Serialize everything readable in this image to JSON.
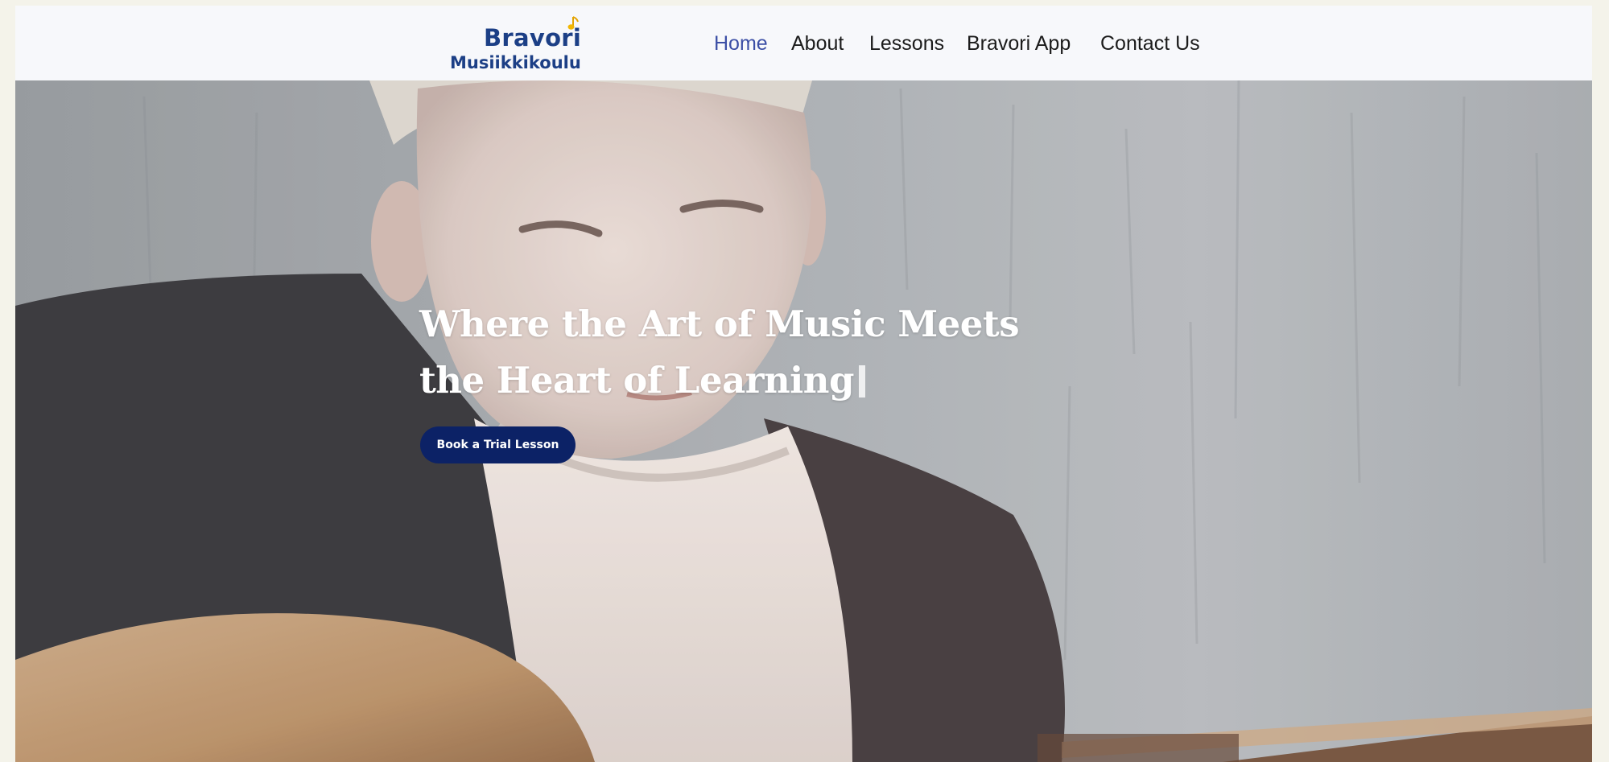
{
  "brand": {
    "name_line1": "Bravori",
    "name_line2": "Musiikkikoulu",
    "accent_color": "#1c3f86",
    "note_icon": "music-note-icon",
    "note_color": "#f2b705"
  },
  "nav": {
    "items": [
      {
        "label": "Home",
        "active": true
      },
      {
        "label": "About",
        "active": false
      },
      {
        "label": "Lessons",
        "active": false
      },
      {
        "label": "Bravori App",
        "active": false
      },
      {
        "label": "Contact Us",
        "active": false
      }
    ],
    "active_color": "#3c4fa6"
  },
  "hero": {
    "title_line1": "Where the Art of Music Meets",
    "title_line2": "the Heart of Learning",
    "cta_label": "Book a Trial Lesson",
    "cta_color": "#0c2266",
    "background_description_icon": "child-playing-guitar-photo"
  }
}
